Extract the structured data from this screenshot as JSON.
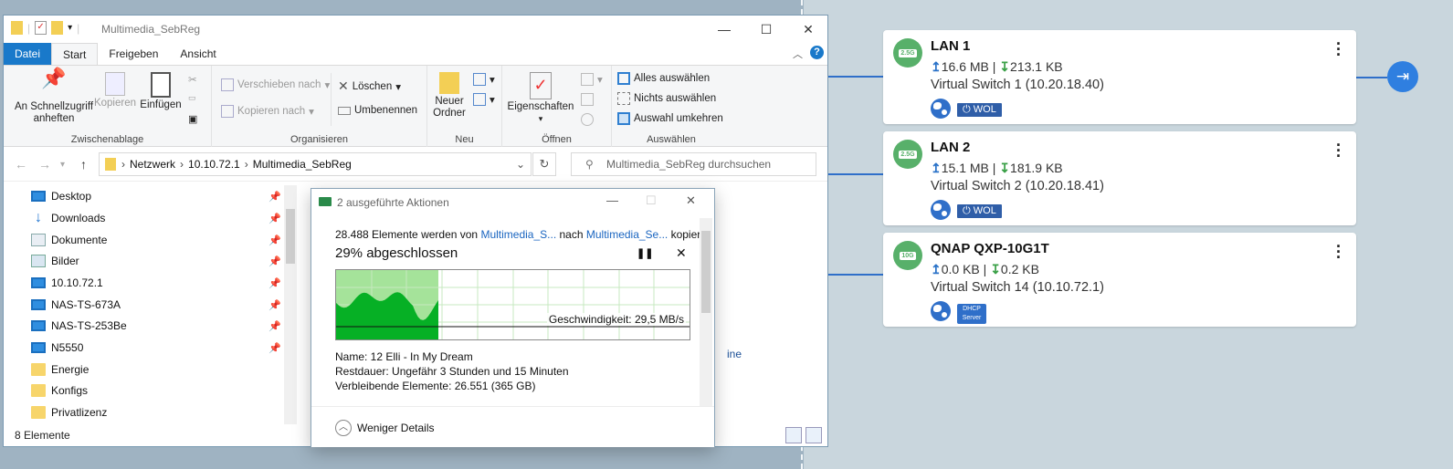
{
  "explorer": {
    "title": "Multimedia_SebReg",
    "tabs": [
      "Datei",
      "Start",
      "Freigeben",
      "Ansicht"
    ],
    "help": "?",
    "ribbon": {
      "clipboard": {
        "pin": "An Schnellzugriff\nanheften",
        "copy": "Kopieren",
        "paste": "Einfügen",
        "label": "Zwischenablage"
      },
      "organize": {
        "move": "Verschieben nach",
        "copyto": "Kopieren nach",
        "delete": "Löschen",
        "rename": "Umbenennen",
        "label": "Organisieren"
      },
      "new": {
        "folder": "Neuer\nOrdner",
        "label": "Neu"
      },
      "open": {
        "props": "Eigenschaften",
        "label": "Öffnen"
      },
      "select": {
        "all": "Alles auswählen",
        "none": "Nichts auswählen",
        "invert": "Auswahl umkehren",
        "label": "Auswählen"
      }
    },
    "address": {
      "parts": [
        "Netzwerk",
        "10.10.72.1",
        "Multimedia_SebReg"
      ]
    },
    "search_placeholder": "Multimedia_SebReg durchsuchen",
    "nav": [
      {
        "label": "Desktop",
        "icon": "desktop-icon",
        "pinned": true
      },
      {
        "label": "Downloads",
        "icon": "download-icon",
        "pinned": true
      },
      {
        "label": "Dokumente",
        "icon": "document-icon",
        "pinned": true
      },
      {
        "label": "Bilder",
        "icon": "picture-icon",
        "pinned": true
      },
      {
        "label": "10.10.72.1",
        "icon": "computer-icon",
        "pinned": true
      },
      {
        "label": "NAS-TS-673A",
        "icon": "computer-icon",
        "pinned": true
      },
      {
        "label": "NAS-TS-253Be",
        "icon": "computer-icon",
        "pinned": true
      },
      {
        "label": "N5550",
        "icon": "computer-icon",
        "pinned": true
      },
      {
        "label": "Energie",
        "icon": "folder-icon",
        "pinned": false
      },
      {
        "label": "Konfigs",
        "icon": "folder-icon",
        "pinned": false
      },
      {
        "label": "Privatlizenz",
        "icon": "folder-icon",
        "pinned": false
      }
    ],
    "status": "8 Elemente",
    "stray_text": "ine"
  },
  "dialog": {
    "title": "2 ausgeführte Aktionen",
    "line_pre": "28.488 Elemente werden von ",
    "source": "Multimedia_S...",
    "line_mid": " nach ",
    "dest": "Multimedia_Se...",
    "line_post": " kopiert",
    "percent_text": "29% abgeschlossen",
    "progress": 0.29,
    "speed": "Geschwindigkeit: 29,5 MB/s",
    "name": "Name:  12 Elli - In My Dream",
    "remaining_time": "Restdauer:  Ungefähr 3 Stunden und 15 Minuten",
    "remaining_items": "Verbleibende Elemente:  26.551 (365 GB)",
    "less_details": "Weniger Details"
  },
  "cards": [
    {
      "title": "LAN 1",
      "port": "2.5G",
      "up": "16.6 MB",
      "down": "213.1 KB",
      "switch": "Virtual Switch 1 (10.20.18.40)",
      "badge": "WOL"
    },
    {
      "title": "LAN 2",
      "port": "2.5G",
      "up": "15.1 MB",
      "down": "181.9 KB",
      "switch": "Virtual Switch 2 (10.20.18.41)",
      "badge": "WOL"
    },
    {
      "title": "QNAP QXP-10G1T",
      "port": "10G",
      "up": "0.0 KB",
      "down": "0.2 KB",
      "switch": "Virtual Switch 14 (10.10.72.1)",
      "badge": "DHCP\nServer"
    }
  ],
  "colors": {
    "accent": "#1979ca",
    "progress_fill": "#a5e39a",
    "graph_fill": "#06b025",
    "port_green": "#58b06a"
  }
}
